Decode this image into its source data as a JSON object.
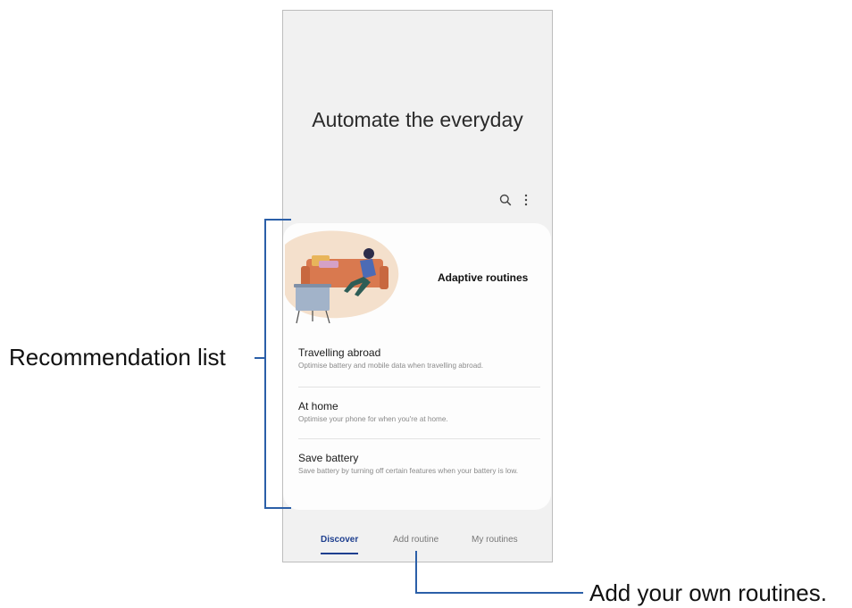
{
  "screen": {
    "hero_title": "Automate the everyday",
    "toolbar": {
      "search_icon": "search-icon",
      "more_icon": "more-vertical-icon"
    },
    "card": {
      "title": "Adaptive routines",
      "items": [
        {
          "title": "Travelling abroad",
          "description": "Optimise battery and mobile data when travelling abroad."
        },
        {
          "title": "At home",
          "description": "Optimise your phone for when you're at home."
        },
        {
          "title": "Save battery",
          "description": "Save battery by turning off certain features when your battery is low."
        }
      ]
    },
    "bottom_nav": {
      "tabs": [
        {
          "label": "Discover",
          "active": true
        },
        {
          "label": "Add routine",
          "active": false
        },
        {
          "label": "My routines",
          "active": false
        }
      ],
      "accent": "#1e3f8f"
    }
  },
  "callouts": {
    "recommendation_list": "Recommendation list",
    "add_routine": "Add your own routines."
  },
  "colors": {
    "callout_line": "#2b5fa8",
    "screen_bg": "#f1f1f1",
    "card_bg": "#fdfdfd"
  }
}
